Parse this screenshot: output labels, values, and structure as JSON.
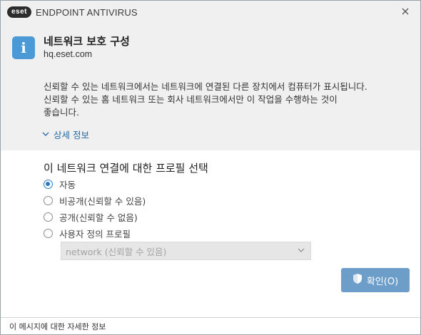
{
  "titlebar": {
    "logo_text": "eset",
    "app_title": "ENDPOINT ANTIVIRUS",
    "close_icon": "close-icon"
  },
  "info": {
    "icon": "info-icon",
    "heading": "네트워크 보호 구성",
    "host": "hq.eset.com",
    "description_line1": "신뢰할 수 있는 네트워크에서는 네트워크에 연결된 다른 장치에서 컴퓨터가 표시됩니다.",
    "description_line2": "신뢰할 수 있는 홈 네트워크 또는 회사 네트워크에서만 이 작업을 수행하는 것이",
    "description_line3": "좋습니다.",
    "details_link": "상세 정보"
  },
  "profile": {
    "title": "이 네트워크 연결에 대한 프로필 선택",
    "options": [
      {
        "label": "자동",
        "checked": true
      },
      {
        "label": "비공개(신뢰할 수 있음)",
        "checked": false
      },
      {
        "label": "공개(신뢰할 수 없음)",
        "checked": false
      },
      {
        "label": "사용자 정의 프로필",
        "checked": false
      }
    ],
    "custom_select_value": "network (신뢰할 수 있음)"
  },
  "ok_button": {
    "label": "확인(O)",
    "icon": "shield-icon"
  },
  "footer": {
    "text": "이 메시지에 대한 자세한 정보"
  },
  "colors": {
    "accent": "#2c79c0",
    "button": "#6c9ec9",
    "link": "#2369a8",
    "info_icon": "#4b9ad6"
  }
}
